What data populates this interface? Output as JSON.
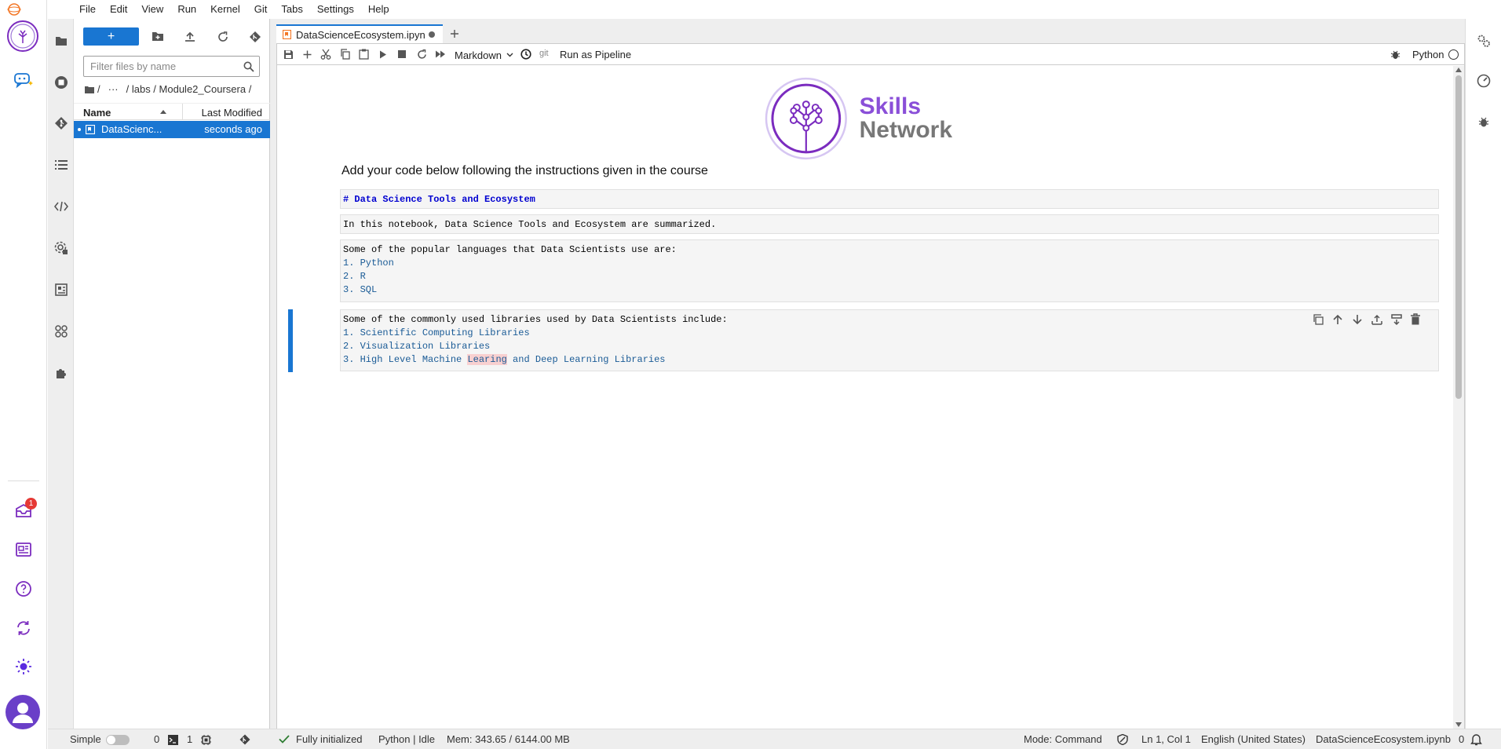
{
  "menubar": {
    "items": [
      "File",
      "Edit",
      "View",
      "Run",
      "Kernel",
      "Git",
      "Tabs",
      "Settings",
      "Help"
    ]
  },
  "outer_rail": {
    "notification_count": "1"
  },
  "filebrowser": {
    "new_label": "+",
    "filter_placeholder": "Filter files by name",
    "breadcrumb": [
      "/",
      "···",
      "/ labs / Module2_Coursera /"
    ],
    "col_name": "Name",
    "col_modified": "Last Modified",
    "files": [
      {
        "name": "DataScienc...",
        "modified": "seconds ago"
      }
    ]
  },
  "tabs": [
    {
      "label": "DataScienceEcosystem.ipyn"
    }
  ],
  "toolbar": {
    "cell_type": "Markdown",
    "git_label": "git",
    "pipeline_label": "Run as Pipeline",
    "kernel_name": "Python"
  },
  "notebook": {
    "logo_word1": "Skills",
    "logo_word2": "Network",
    "intro_heading": "Add your code below following the instructions given in the course",
    "cells": {
      "c1": "# Data Science Tools and Ecosystem",
      "c2": "In this notebook, Data Science Tools and Ecosystem are summarized.",
      "c3_intro": "Some of the popular languages that Data Scientists use are:",
      "c3_items": [
        "1. ",
        "Python",
        "2. ",
        "R",
        "3. ",
        "SQL"
      ],
      "c4_intro": "Some of the commonly used libraries used by Data Scientists include:",
      "c4_items": [
        "1. ",
        "Scientific Computing Libraries",
        "2. ",
        "Visualization Libraries",
        "3. ",
        "High Level Machine ",
        "Learing",
        " and Deep Learning Libraries"
      ]
    }
  },
  "statusbar": {
    "mode_label": "Simple",
    "terminals": "0",
    "kernels": "1",
    "init_status": "Fully initialized",
    "kernel_status": "Python | Idle",
    "memory": "Mem: 343.65 / 6144.00 MB",
    "mode": "Mode: Command",
    "cursor": "Ln 1, Col 1",
    "language": "English (United States)",
    "filename": "DataScienceEcosystem.ipynb",
    "notifications": "0"
  },
  "colors": {
    "accent": "#1976d2",
    "purple": "#7b2cbf",
    "logo_purple": "#8a4fd8"
  }
}
